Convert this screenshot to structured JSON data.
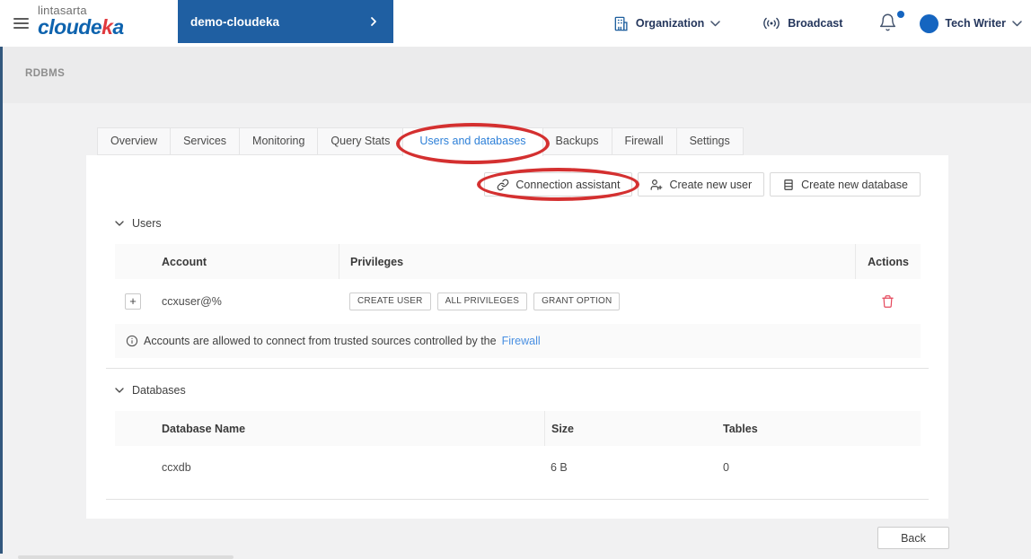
{
  "header": {
    "logo_top": "lintasarta",
    "logo_part1": "cloude",
    "logo_accent": "k",
    "logo_part2": "a",
    "project_name": "demo-cloudeka",
    "organization_label": "Organization",
    "broadcast_label": "Broadcast",
    "user_name": "Tech Writer"
  },
  "breadcrumb": "RDBMS",
  "tabs": [
    {
      "label": "Overview",
      "active": false
    },
    {
      "label": "Services",
      "active": false
    },
    {
      "label": "Monitoring",
      "active": false
    },
    {
      "label": "Query Stats",
      "active": false
    },
    {
      "label": "Users and databases",
      "active": true
    },
    {
      "label": "Backups",
      "active": false
    },
    {
      "label": "Firewall",
      "active": false
    },
    {
      "label": "Settings",
      "active": false
    }
  ],
  "toolbar": {
    "connection_assistant_label": "Connection assistant",
    "create_user_label": "Create new user",
    "create_database_label": "Create new database"
  },
  "users_section": {
    "title": "Users",
    "columns": {
      "account": "Account",
      "privileges": "Privileges",
      "actions": "Actions"
    },
    "rows": [
      {
        "expand": "+",
        "account": "ccxuser@%",
        "privileges": [
          "CREATE USER",
          "ALL PRIVILEGES",
          "GRANT OPTION"
        ]
      }
    ],
    "note_text": "Accounts are allowed to connect from trusted sources controlled by the",
    "note_link": "Firewall"
  },
  "databases_section": {
    "title": "Databases",
    "columns": {
      "name": "Database Name",
      "size": "Size",
      "tables": "Tables"
    },
    "rows": [
      {
        "name": "ccxdb",
        "size": "6 B",
        "tables": "0"
      }
    ]
  },
  "footer": {
    "back_label": "Back"
  },
  "colors": {
    "brand_blue": "#0e63ae",
    "brand_red": "#e0393e",
    "project_box_blue": "#1f5fa2",
    "active_tab_blue": "#2e80d8",
    "annotation_red": "#d43030",
    "danger_red": "#e5485c",
    "link_blue": "#4a90e2",
    "sidebar_strip": "#33587e"
  }
}
